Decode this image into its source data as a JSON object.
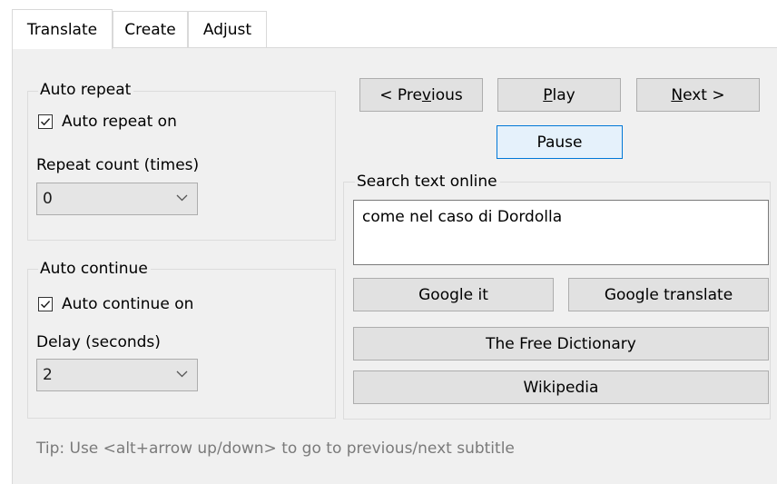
{
  "tabs": [
    {
      "label": "Translate",
      "active": true
    },
    {
      "label": "Create",
      "active": false
    },
    {
      "label": "Adjust",
      "active": false
    }
  ],
  "auto_repeat": {
    "group_label": "Auto repeat",
    "checkbox_label": "Auto repeat on",
    "checked": true,
    "count_label": "Repeat count (times)",
    "count_value": "0"
  },
  "auto_continue": {
    "group_label": "Auto continue",
    "checkbox_label": "Auto continue on",
    "checked": true,
    "delay_label": "Delay (seconds)",
    "delay_value": "2"
  },
  "navigation": {
    "previous": {
      "pre": "< Pre",
      "mnemonic": "v",
      "post": "ious"
    },
    "play": {
      "pre": "",
      "mnemonic": "P",
      "post": "lay"
    },
    "next": {
      "pre": "",
      "mnemonic": "N",
      "post": "ext >"
    },
    "pause": "Pause"
  },
  "search": {
    "group_label": "Search text online",
    "text": "come nel caso di Dordolla",
    "google_it": "Google it",
    "google_translate": "Google translate",
    "free_dictionary": "The Free Dictionary",
    "wikipedia": "Wikipedia"
  },
  "tip": "Tip: Use <alt+arrow up/down> to go to previous/next subtitle"
}
